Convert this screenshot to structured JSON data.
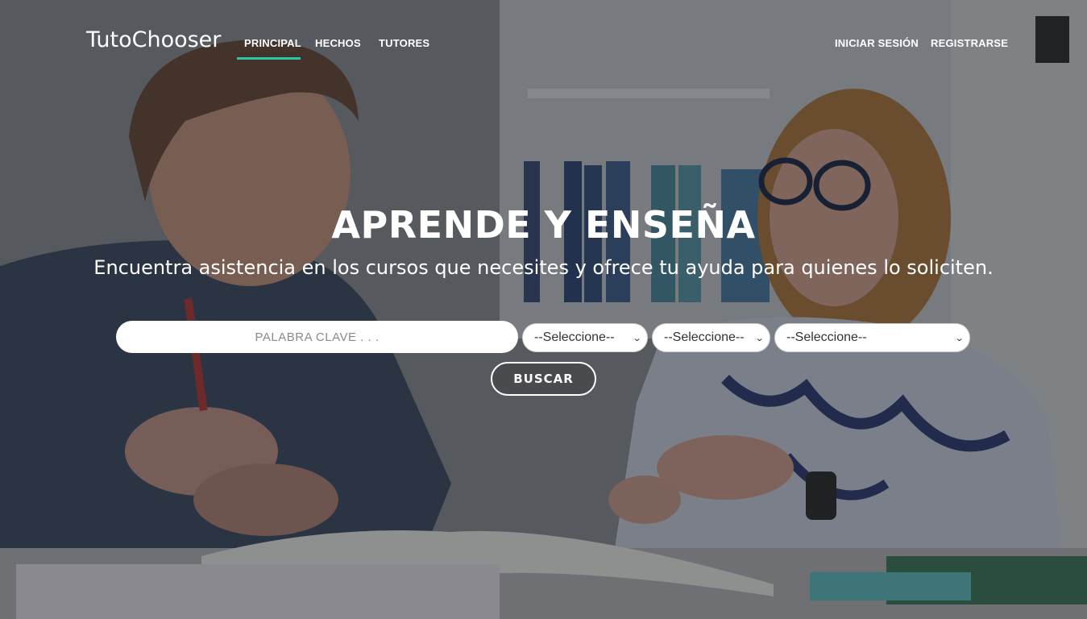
{
  "nav": {
    "brand": "TutoChooser",
    "links": [
      {
        "label": "PRINCIPAL",
        "active": true
      },
      {
        "label": "HECHOS",
        "active": false
      },
      {
        "label": "TUTORES",
        "active": false
      }
    ],
    "right_links": [
      {
        "label": "INICIAR SESIÓN"
      },
      {
        "label": "REGISTRARSE"
      }
    ],
    "active_color": "#2ec4a6"
  },
  "hero": {
    "title": "APRENDE Y ENSEÑA",
    "subtitle": "Encuentra asistencia en los cursos que necesites y ofrece tu ayuda para quienes lo soliciten."
  },
  "search": {
    "placeholder": "PALABRA CLAVE . . .",
    "value": "",
    "selects": [
      {
        "value": "--Seleccione--"
      },
      {
        "value": "--Seleccione--"
      },
      {
        "value": "--Seleccione--"
      }
    ],
    "button_label": "BUSCAR"
  }
}
